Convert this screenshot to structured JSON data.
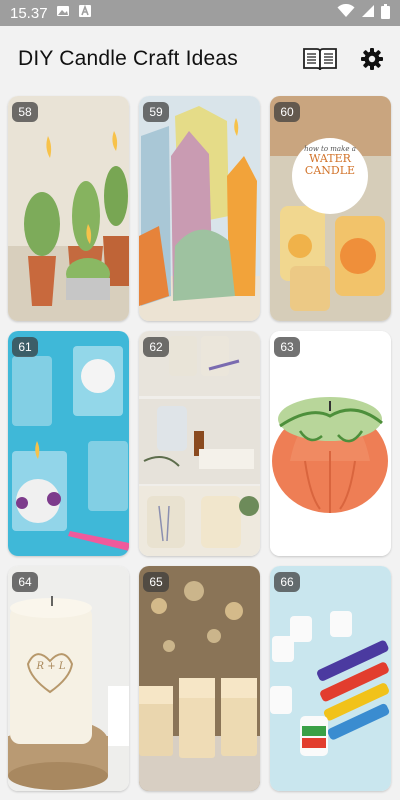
{
  "status_bar": {
    "time": "15.37",
    "icons": [
      "image-icon",
      "text-a-icon",
      "wifi-icon",
      "signal-icon",
      "battery-icon"
    ]
  },
  "app_bar": {
    "title": "DIY Candle Craft Ideas",
    "actions": [
      "book-icon",
      "gear-icon"
    ]
  },
  "colors": {
    "status_bar_bg": "#9e9e9e",
    "background": "#f2f2f2",
    "badge_bg": "#3c3c3c"
  },
  "cards": [
    {
      "number": "58",
      "image": "cactus-candles"
    },
    {
      "number": "59",
      "image": "crystal-candles"
    },
    {
      "number": "60",
      "image": "water-candle",
      "overlay": {
        "line1": "how to make a",
        "line2": "WATER",
        "line3": "CANDLE"
      }
    },
    {
      "number": "61",
      "image": "glass-votive-candles"
    },
    {
      "number": "62",
      "image": "herb-jar-candles"
    },
    {
      "number": "63",
      "image": "pumpkin-candle"
    },
    {
      "number": "64",
      "image": "engraved-pillar-candle",
      "engraving": "R + L"
    },
    {
      "number": "65",
      "image": "gold-glass-candles"
    },
    {
      "number": "66",
      "image": "painted-tealights"
    }
  ]
}
